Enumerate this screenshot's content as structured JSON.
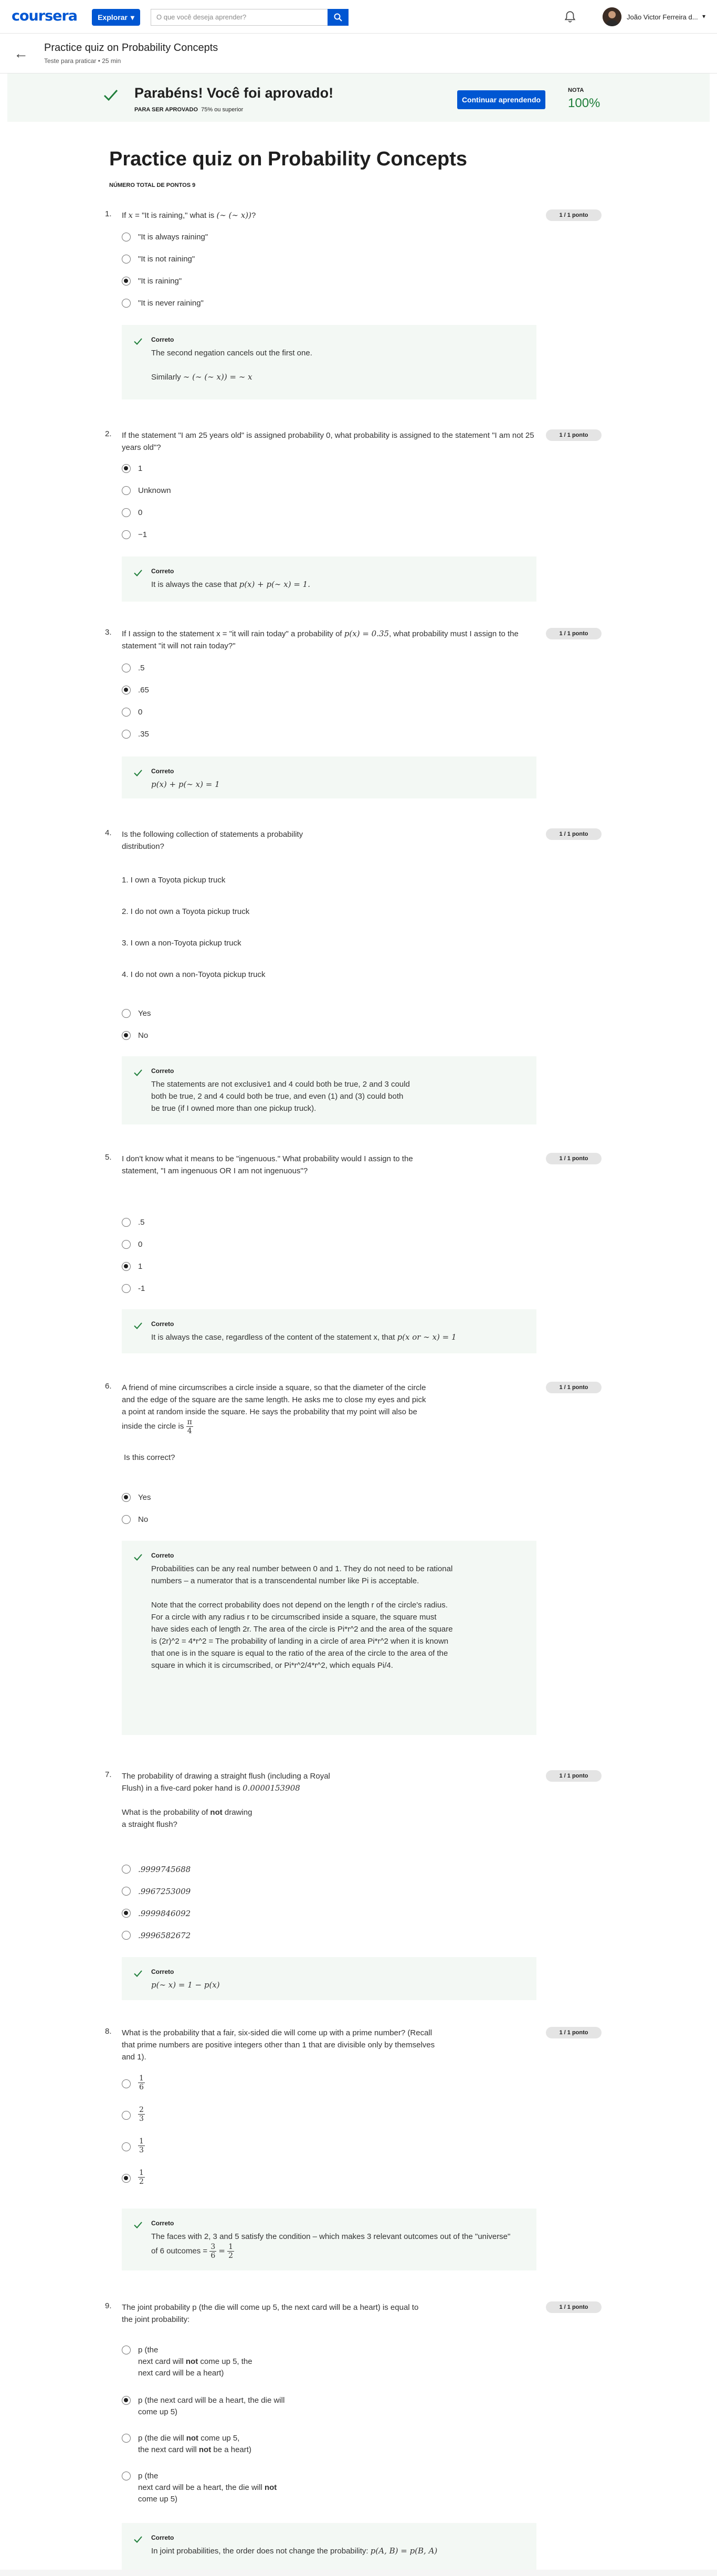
{
  "topbar": {
    "logo": "coursera",
    "explore_label": "Explorar",
    "search_placeholder": "O que você deseja aprender?",
    "username": "João Victor Ferreira d..."
  },
  "header": {
    "title": "Practice quiz on Probability Concepts",
    "subtitle": "Teste para praticar • 25 min"
  },
  "banner": {
    "title": "Parabéns! Você foi aprovado!",
    "pass_label": "PARA SER APROVADO",
    "pass_value": "75% ou superior",
    "continue_label": "Continuar aprendendo",
    "grade_label": "NOTA",
    "grade_value": "100%"
  },
  "page": {
    "h1": "Practice quiz on Probability Concepts",
    "total_points": "NÚMERO TOTAL DE PONTOS 9"
  },
  "feedback_label": "Correto",
  "badge_label": "1 / 1 ponto",
  "questions": [
    {
      "num": "1.",
      "text_a": "If",
      "text_b": "= \"It is raining,\" what is",
      "text_c": "?",
      "options": [
        "\"It is always raining\"",
        "\"It is not raining\"",
        "\"It is raining\"",
        "\"It is never raining\""
      ],
      "feedback_1": "The second negation cancels out the first one.",
      "feedback_2": "Similarly"
    },
    {
      "num": "2.",
      "text": "If the statement \"I am 25 years old\" is assigned probability 0, what probability is assigned to the statement \"I am not 25 years old\"?",
      "options": [
        "1",
        "Unknown",
        "0",
        "−1"
      ],
      "feedback": "It is always the case that"
    },
    {
      "num": "3.",
      "text_a": "If I assign to the statement x = \"it will rain today\" a probability of",
      "text_b": ", what probability must I assign to the statement \"it will not rain today?\"",
      "options": [
        ".5",
        ".65",
        "0",
        ".35"
      ]
    },
    {
      "num": "4.",
      "text": "Is the following collection of statements a probability distribution?",
      "statements": [
        "1. I own a Toyota pickup truck",
        "2. I do not own a Toyota pickup truck",
        "3. I own a non-Toyota pickup truck",
        "4. I do not own a non-Toyota pickup truck"
      ],
      "options": [
        "Yes",
        "No"
      ],
      "feedback": "The statements are not exclusive1 and 4 could both be true, 2 and 3 could both be true, 2 and 4 could both be true, and even (1) and (3) could both be true (if I owned more than one pickup truck)."
    },
    {
      "num": "5.",
      "text": "I don't know what it means to be \"ingenuous.\" What probability would I assign to the statement, \"I am ingenuous OR I am not ingenuous\"?",
      "options": [
        ".5",
        "0",
        "1",
        "-1"
      ],
      "feedback": "It is always the case, regardless of the content of the statement x, that"
    },
    {
      "num": "6.",
      "text": "A friend of mine circumscribes a circle inside a square, so that the diameter of the circle and the edge of the square are the same length. He asks me to close my eyes and pick a point at random inside the square. He says the probability that my point will also be inside the circle is",
      "question": "Is this correct?",
      "options": [
        "Yes",
        "No"
      ],
      "feedback_1": "Probabilities can be any real number between 0 and 1. They do not need to be rational numbers – a numerator that is a transcendental number like Pi is acceptable.",
      "feedback_2": "Note that the correct probability does not depend on the length r of the circle's radius. For a circle with any radius r to be circumscribed inside a square, the square must have sides each of length 2r. The area of the circle is Pi*r^2 and the area of the square is (2r)^2 = 4*r^2 = The probability of landing in a circle of area Pi*r^2 when it is known that one is in the square is equal to the ratio of the area of the circle to the area of the square in which it is circumscribed, or Pi*r^2/4*r^2, which equals Pi/4."
    },
    {
      "num": "7.",
      "text_a": "The probability of drawing a straight flush (including a Royal Flush) in a five-card poker hand is",
      "text_value": "0.0000153908",
      "text_b": "What is the probability of",
      "text_bold": "not",
      "text_c": "drawing a straight flush?",
      "options": [
        ".9999745688",
        ".9967253009",
        ".9999846092",
        ".9996582672"
      ]
    },
    {
      "num": "8.",
      "text": "What is the probability that a fair, six-sided die will come up with a prime number? (Recall that prime numbers are positive integers other than 1 that are divisible only by themselves and 1).",
      "options": [
        [
          "1",
          "6"
        ],
        [
          "2",
          "3"
        ],
        [
          "1",
          "3"
        ],
        [
          "1",
          "2"
        ]
      ],
      "feedback_a": "The faces with 2, 3 and 5 satisfy the condition – which makes 3 relevant outcomes out of the \"universe\" of 6 outcomes =",
      "feedback_fracs": [
        "3",
        "6",
        "1",
        "2"
      ]
    },
    {
      "num": "9.",
      "text": "The joint probability p (the die will come up 5, the next card will be a heart) is equal to the joint probability:",
      "options": [
        [
          "p (the",
          "next card will",
          "not",
          "come up 5, the",
          "next card will be a heart)"
        ],
        [
          "p (the next card will be a heart, the die will",
          "come up 5)"
        ],
        [
          "p (the die will",
          "not",
          "come up 5,",
          "the next card will",
          "not",
          "be a heart)"
        ],
        [
          "p (the",
          "next card will be a heart, the die will",
          "not",
          "come up 5)"
        ]
      ],
      "feedback": "In joint probabilities, the order does not change the probability:"
    }
  ]
}
